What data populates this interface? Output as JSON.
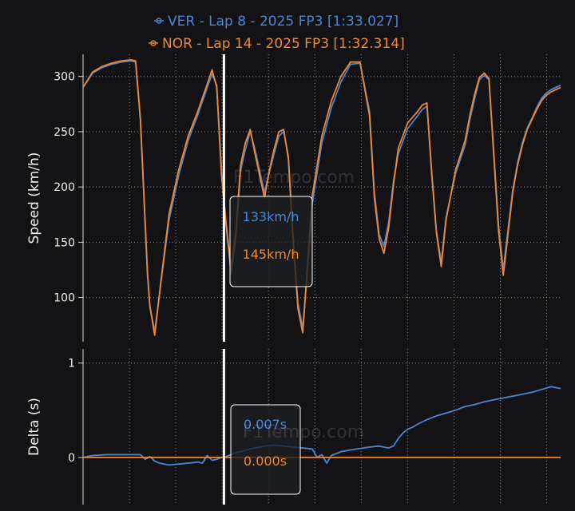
{
  "chart_data": [
    {
      "type": "line",
      "title": "",
      "xlabel": "",
      "ylabel": "Speed (km/h)",
      "ylim": [
        60,
        320
      ],
      "yticks": [
        100,
        150,
        200,
        250,
        300
      ],
      "xlim": [
        0,
        100
      ],
      "grid": true,
      "legend": "top-center",
      "series": [
        {
          "name": "VER - Lap 8 - 2025 FP3 [1:33.027]",
          "color": "#4a86d8",
          "x": [
            0,
            2,
            4,
            6,
            8,
            10,
            11,
            12,
            13.5,
            14,
            15,
            16.5,
            18,
            20,
            22,
            24,
            26,
            27,
            28,
            29,
            30,
            31,
            32,
            33,
            34,
            35,
            36,
            37,
            38,
            39,
            40,
            41,
            42,
            43,
            44,
            45,
            46,
            47,
            48,
            50,
            52,
            54,
            56,
            58,
            60,
            61,
            62,
            63,
            64,
            65,
            66,
            68,
            70,
            71,
            72,
            73,
            74,
            75,
            76,
            78,
            80,
            81,
            82,
            83,
            84,
            85,
            86,
            87,
            88,
            89,
            90,
            91,
            92,
            93,
            94,
            95,
            96,
            97,
            98,
            99,
            100
          ],
          "y": [
            290,
            303,
            308,
            311,
            313,
            314,
            313,
            260,
            120,
            92,
            69,
            120,
            170,
            210,
            242,
            265,
            290,
            302,
            292,
            215,
            163,
            121,
            156,
            215,
            234,
            250,
            234,
            214,
            195,
            213,
            230,
            246,
            250,
            228,
            155,
            95,
            72,
            125,
            185,
            240,
            272,
            295,
            311,
            312,
            268,
            195,
            157,
            146,
            168,
            205,
            230,
            253,
            264,
            270,
            273,
            215,
            160,
            132,
            172,
            212,
            238,
            261,
            280,
            297,
            301,
            297,
            232,
            165,
            125,
            162,
            198,
            222,
            240,
            253,
            262,
            272,
            280,
            285,
            288,
            290,
            292
          ],
          "point_label": "133km/h"
        },
        {
          "name": "NOR - Lap 14 - 2025 FP3 [1:32.314]",
          "color": "#f0882e",
          "x": [
            0,
            2,
            4,
            6,
            8,
            10,
            11,
            12,
            13.5,
            14,
            15,
            16.5,
            18,
            20,
            22,
            24,
            26,
            27,
            28,
            29,
            30,
            31,
            32,
            33,
            34,
            35,
            36,
            37,
            38,
            39,
            40,
            41,
            42,
            43,
            44,
            45,
            46,
            47,
            48,
            50,
            52,
            54,
            56,
            58,
            60,
            61,
            62,
            63,
            64,
            65,
            66,
            68,
            70,
            71,
            72,
            73,
            74,
            75,
            76,
            78,
            80,
            81,
            82,
            83,
            84,
            85,
            86,
            87,
            88,
            89,
            90,
            91,
            92,
            93,
            94,
            95,
            96,
            97,
            98,
            99,
            100
          ],
          "y": [
            290,
            304,
            309,
            312,
            314,
            315,
            314,
            262,
            122,
            92,
            66,
            122,
            175,
            215,
            246,
            268,
            293,
            306,
            290,
            210,
            165,
            125,
            160,
            220,
            240,
            252,
            230,
            210,
            190,
            215,
            234,
            250,
            252,
            225,
            150,
            90,
            68,
            130,
            192,
            246,
            278,
            300,
            313,
            313,
            264,
            190,
            153,
            140,
            163,
            202,
            235,
            258,
            268,
            274,
            276,
            212,
            158,
            128,
            170,
            215,
            242,
            265,
            284,
            299,
            303,
            298,
            228,
            160,
            120,
            158,
            196,
            220,
            238,
            252,
            261,
            270,
            278,
            283,
            286,
            288,
            290
          ],
          "point_label": "145km/h"
        }
      ],
      "cursor_x": 29.5,
      "tooltip": [
        "133km/h",
        "145km/h"
      ]
    },
    {
      "type": "line",
      "title": "",
      "xlabel": "",
      "ylabel": "Delta (s)",
      "ylim": [
        -0.5,
        1.15
      ],
      "yticks": [
        0,
        1
      ],
      "xlim": [
        0,
        100
      ],
      "grid": true,
      "series": [
        {
          "name": "VER",
          "color": "#4a86d8",
          "x": [
            0,
            2,
            5,
            8,
            10,
            12,
            13,
            14,
            15,
            16,
            17,
            18,
            20,
            22,
            24,
            25,
            26,
            27,
            28,
            29,
            30,
            31,
            32,
            33,
            35,
            38,
            40,
            42,
            44,
            46,
            48,
            49,
            50,
            51,
            52,
            54,
            56,
            60,
            62,
            64,
            65,
            66,
            67,
            68,
            69,
            70,
            72,
            74,
            76,
            78,
            80,
            82,
            84,
            86,
            88,
            90,
            92,
            94,
            96,
            98,
            100
          ],
          "y": [
            0,
            0.02,
            0.03,
            0.03,
            0.03,
            0.03,
            -0.02,
            0.01,
            -0.04,
            -0.06,
            -0.07,
            -0.08,
            -0.07,
            -0.06,
            -0.05,
            -0.06,
            0.02,
            -0.03,
            -0.02,
            0.0,
            0.01,
            0.03,
            0.05,
            0.06,
            0.09,
            0.12,
            0.13,
            0.12,
            0.11,
            0.1,
            0.09,
            0.0,
            0.03,
            -0.06,
            0.02,
            0.06,
            0.08,
            0.11,
            0.12,
            0.1,
            0.12,
            0.2,
            0.26,
            0.3,
            0.32,
            0.35,
            0.4,
            0.44,
            0.47,
            0.5,
            0.54,
            0.56,
            0.59,
            0.61,
            0.63,
            0.65,
            0.67,
            0.69,
            0.72,
            0.75,
            0.73
          ],
          "point_label": "0.007s"
        },
        {
          "name": "NOR",
          "color": "#f0882e",
          "x": [
            0,
            100
          ],
          "y": [
            0,
            0
          ],
          "point_label": "0.000s"
        }
      ],
      "cursor_x": 29.5,
      "tooltip": [
        "0.007s",
        "0.000s"
      ]
    }
  ],
  "watermark": "F1Tempo.com"
}
